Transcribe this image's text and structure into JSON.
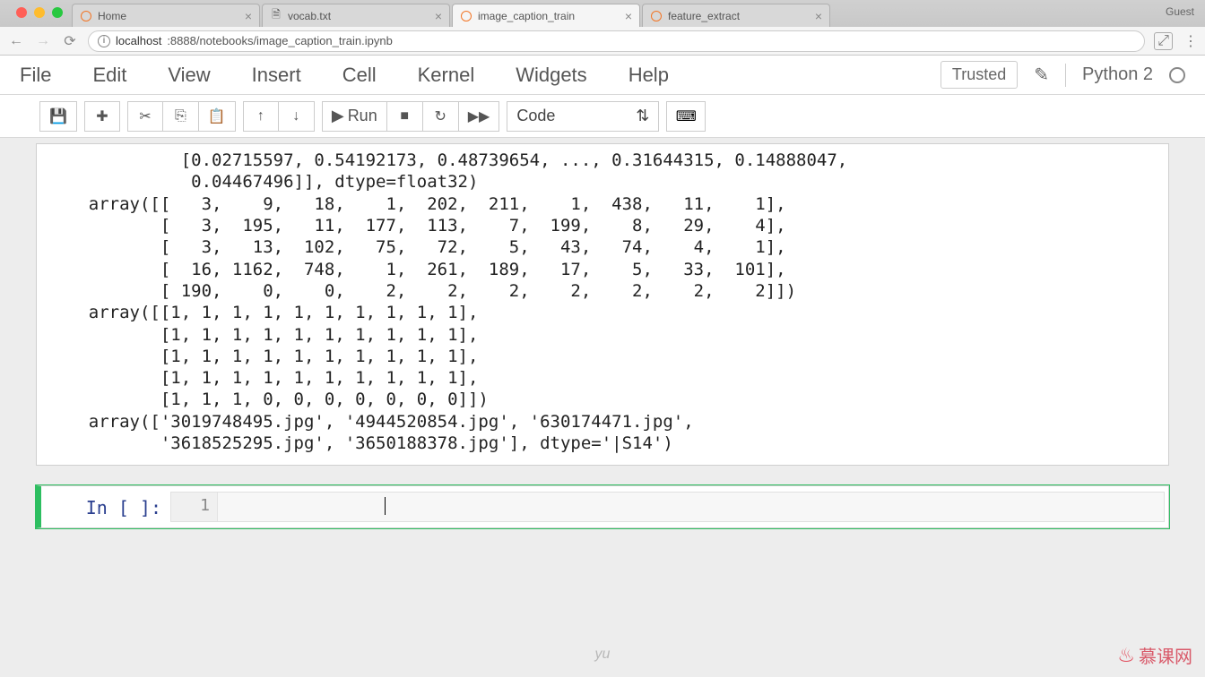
{
  "browser": {
    "tabs": [
      {
        "title": "Home"
      },
      {
        "title": "vocab.txt"
      },
      {
        "title": "image_caption_train"
      },
      {
        "title": "feature_extract"
      }
    ],
    "guest_label": "Guest",
    "url_host": "localhost",
    "url_path": ":8888/notebooks/image_caption_train.ipynb"
  },
  "menubar": {
    "items": [
      "File",
      "Edit",
      "View",
      "Insert",
      "Cell",
      "Kernel",
      "Widgets",
      "Help"
    ],
    "trusted": "Trusted",
    "kernel": "Python 2"
  },
  "toolbar": {
    "run_label": "Run",
    "cell_type": "Code"
  },
  "output_text": "             [0.02715597, 0.54192173, 0.48739654, ..., 0.31644315, 0.14888047,\n              0.04467496]], dtype=float32)\n    array([[   3,    9,   18,    1,  202,  211,    1,  438,   11,    1],\n           [   3,  195,   11,  177,  113,    7,  199,    8,   29,    4],\n           [   3,   13,  102,   75,   72,    5,   43,   74,    4,    1],\n           [  16, 1162,  748,    1,  261,  189,   17,    5,   33,  101],\n           [ 190,    0,    0,    2,    2,    2,    2,    2,    2,    2]])\n    array([[1, 1, 1, 1, 1, 1, 1, 1, 1, 1],\n           [1, 1, 1, 1, 1, 1, 1, 1, 1, 1],\n           [1, 1, 1, 1, 1, 1, 1, 1, 1, 1],\n           [1, 1, 1, 1, 1, 1, 1, 1, 1, 1],\n           [1, 1, 1, 0, 0, 0, 0, 0, 0, 0]])\n    array(['3019748495.jpg', '4944520854.jpg', '630174471.jpg',\n           '3618525295.jpg', '3650188378.jpg'], dtype='|S14')",
  "input_cell": {
    "prompt": "In [ ]:",
    "line_number": "1"
  },
  "footer": {
    "text": "yu",
    "watermark": "慕课网"
  }
}
